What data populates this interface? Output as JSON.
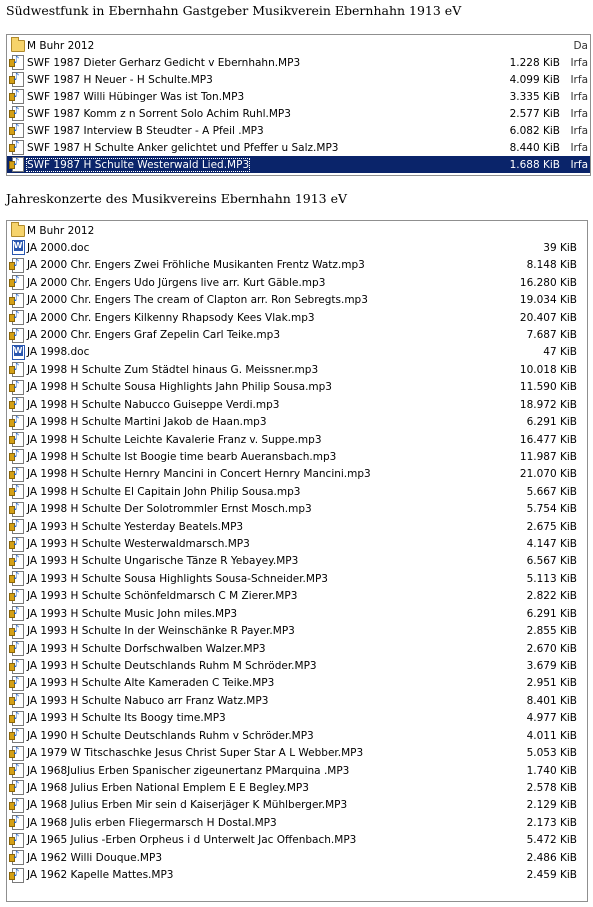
{
  "heading1": "Südwestfunk in Ebernhahn Gastgeber Musikverein Ebernhahn 1913 eV",
  "heading2": "Jahreskonzerte des Musikvereins Ebernhahn 1913 eV",
  "panel1": {
    "rows": [
      {
        "icon": "folder-icon",
        "name": "M Buhr 2012",
        "size": "",
        "extra": "Da"
      },
      {
        "icon": "audio-file-icon",
        "name": "SWF 1987 Dieter Gerharz Gedicht v Ebernhahn.MP3",
        "size": "1.228 KiB",
        "extra": "Irfa"
      },
      {
        "icon": "audio-file-icon",
        "name": "SWF 1987 H Neuer - H Schulte.MP3",
        "size": "4.099 KiB",
        "extra": "Irfa"
      },
      {
        "icon": "audio-file-icon",
        "name": "SWF 1987 Willi Hübinger Was ist Ton.MP3",
        "size": "3.335 KiB",
        "extra": "Irfa"
      },
      {
        "icon": "audio-file-icon",
        "name": "SWF 1987 Komm z n Sorrent Solo Achim Ruhl.MP3",
        "size": "2.577 KiB",
        "extra": "Irfa"
      },
      {
        "icon": "audio-file-icon",
        "name": "SWF 1987 Interview B Steudter - A Pfeil .MP3",
        "size": "6.082 KiB",
        "extra": "Irfa"
      },
      {
        "icon": "audio-file-icon",
        "name": "SWF 1987 H Schulte Anker gelichtet und Pfeffer u Salz.MP3",
        "size": "8.440 KiB",
        "extra": "Irfa"
      },
      {
        "icon": "audio-file-icon",
        "name": "SWF 1987 H Schulte Westerwald Lied.MP3",
        "size": "1.688 KiB",
        "extra": "Irfa",
        "selected": true
      }
    ]
  },
  "panel2": {
    "rows": [
      {
        "icon": "folder-icon",
        "name": "M Buhr 2012",
        "size": ""
      },
      {
        "icon": "word-doc-icon",
        "name": "JA 2000.doc",
        "size": "39 KiB"
      },
      {
        "icon": "audio-file-icon",
        "name": "JA 2000 Chr. Engers Zwei Fröhliche Musikanten Frentz Watz.mp3",
        "size": "8.148 KiB"
      },
      {
        "icon": "audio-file-icon",
        "name": "JA 2000 Chr. Engers Udo Jürgens live arr. Kurt Gäble.mp3",
        "size": "16.280 KiB"
      },
      {
        "icon": "audio-file-icon",
        "name": "JA 2000 Chr. Engers The cream of Clapton arr. Ron Sebregts.mp3",
        "size": "19.034 KiB"
      },
      {
        "icon": "audio-file-icon",
        "name": "JA 2000 Chr. Engers Kilkenny Rhapsody Kees Vlak.mp3",
        "size": "20.407 KiB"
      },
      {
        "icon": "audio-file-icon",
        "name": "JA 2000 Chr. Engers Graf Zepelin Carl Teike.mp3",
        "size": "7.687 KiB"
      },
      {
        "icon": "word-doc-icon",
        "name": "JA 1998.doc",
        "size": "47 KiB"
      },
      {
        "icon": "audio-file-icon",
        "name": "JA 1998 H Schulte Zum Städtel hinaus G. Meissner.mp3",
        "size": "10.018 KiB"
      },
      {
        "icon": "audio-file-icon",
        "name": "JA 1998 H Schulte Sousa Highlights Jahn Philip Sousa.mp3",
        "size": "11.590 KiB"
      },
      {
        "icon": "audio-file-icon",
        "name": "JA 1998 H Schulte Nabucco Guiseppe Verdi.mp3",
        "size": "18.972 KiB"
      },
      {
        "icon": "audio-file-icon",
        "name": "JA 1998 H Schulte Martini Jakob de Haan.mp3",
        "size": "6.291 KiB"
      },
      {
        "icon": "audio-file-icon",
        "name": "JA 1998 H Schulte Leichte Kavalerie Franz v. Suppe.mp3",
        "size": "16.477 KiB"
      },
      {
        "icon": "audio-file-icon",
        "name": "JA 1998 H Schulte Ist Boogie time bearb Aueransbach.mp3",
        "size": "11.987 KiB"
      },
      {
        "icon": "audio-file-icon",
        "name": "JA 1998 H Schulte Hernry Mancini in Concert Hernry Mancini.mp3",
        "size": "21.070 KiB"
      },
      {
        "icon": "audio-file-icon",
        "name": "JA 1998 H Schulte El Capitain John Philip Sousa.mp3",
        "size": "5.667 KiB"
      },
      {
        "icon": "audio-file-icon",
        "name": "JA 1998 H Schulte Der Solotrommler Ernst Mosch.mp3",
        "size": "5.754 KiB"
      },
      {
        "icon": "audio-file-icon",
        "name": "JA 1993 H Schulte Yesterday Beatels.MP3",
        "size": "2.675 KiB"
      },
      {
        "icon": "audio-file-icon",
        "name": "JA 1993 H Schulte Westerwaldmarsch.MP3",
        "size": "4.147 KiB"
      },
      {
        "icon": "audio-file-icon",
        "name": "JA 1993 H Schulte Ungarische Tänze R Yebayey.MP3",
        "size": "6.567 KiB"
      },
      {
        "icon": "audio-file-icon",
        "name": "JA 1993 H Schulte Sousa Highlights Sousa-Schneider.MP3",
        "size": "5.113 KiB"
      },
      {
        "icon": "audio-file-icon",
        "name": "JA 1993 H Schulte Schönfeldmarsch C M Zierer.MP3",
        "size": "2.822 KiB"
      },
      {
        "icon": "audio-file-icon",
        "name": "JA 1993 H Schulte Music John miles.MP3",
        "size": "6.291 KiB"
      },
      {
        "icon": "audio-file-icon",
        "name": "JA 1993 H Schulte In der Weinschänke R Payer.MP3",
        "size": "2.855 KiB"
      },
      {
        "icon": "audio-file-icon",
        "name": "JA 1993 H Schulte Dorfschwalben Walzer.MP3",
        "size": "2.670 KiB"
      },
      {
        "icon": "audio-file-icon",
        "name": "JA 1993 H Schulte Deutschlands Ruhm M Schröder.MP3",
        "size": "3.679 KiB"
      },
      {
        "icon": "audio-file-icon",
        "name": "JA 1993 H Schulte Alte Kameraden C Teike.MP3",
        "size": "2.951 KiB"
      },
      {
        "icon": "audio-file-icon",
        "name": "JA 1993 H Schulte  Nabuco arr Franz Watz.MP3",
        "size": "8.401 KiB"
      },
      {
        "icon": "audio-file-icon",
        "name": "JA 1993 H Schulte  Its Boogy time.MP3",
        "size": "4.977 KiB"
      },
      {
        "icon": "audio-file-icon",
        "name": "JA 1990 H Schulte Deutschlands Ruhm v Schröder.MP3",
        "size": "4.011 KiB"
      },
      {
        "icon": "audio-file-icon",
        "name": "JA 1979 W Titschaschke Jesus Christ Super Star A L Webber.MP3",
        "size": "5.053 KiB"
      },
      {
        "icon": "audio-file-icon",
        "name": "JA 1968Julius Erben Spanischer zigeunertanz PMarquina .MP3",
        "size": "1.740 KiB"
      },
      {
        "icon": "audio-file-icon",
        "name": "JA 1968 Julius Erben National Emplem E E Begley.MP3",
        "size": "2.578 KiB"
      },
      {
        "icon": "audio-file-icon",
        "name": "JA 1968 Julius Erben Mir sein d Kaiserjäger K Mühlberger.MP3",
        "size": "2.129 KiB"
      },
      {
        "icon": "audio-file-icon",
        "name": "JA 1968 Julis erben Fliegermarsch H Dostal.MP3",
        "size": "2.173 KiB"
      },
      {
        "icon": "audio-file-icon",
        "name": "JA 1965 Julius -Erben Orpheus i d Unterwelt Jac Offenbach.MP3",
        "size": "5.472 KiB"
      },
      {
        "icon": "audio-file-icon",
        "name": "JA 1962 Willi Douque.MP3",
        "size": "2.486 KiB"
      },
      {
        "icon": "audio-file-icon",
        "name": "JA 1962 Kapelle Mattes.MP3",
        "size": "2.459 KiB"
      }
    ]
  }
}
